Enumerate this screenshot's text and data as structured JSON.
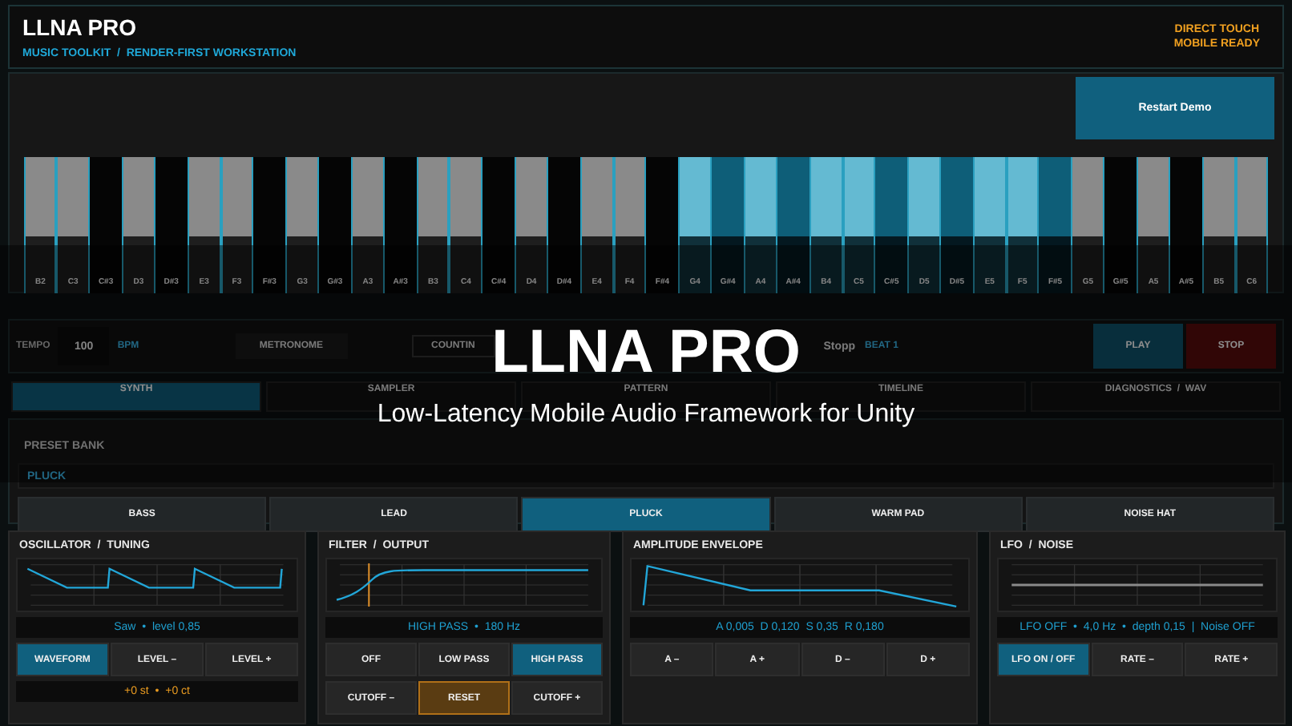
{
  "header": {
    "title": "LLNA PRO",
    "subtitle": "MUSIC TOOLKIT  /  RENDER-FIRST WORKSTATION",
    "badge_lines": [
      "DIRECT TOUCH",
      "MOBILE READY"
    ]
  },
  "restart_button": "Restart Demo",
  "keyboard": {
    "keys": [
      {
        "note": "B2",
        "kind": "white",
        "active": false
      },
      {
        "note": "C3",
        "kind": "white",
        "active": false
      },
      {
        "note": "C#3",
        "kind": "black",
        "active": false
      },
      {
        "note": "D3",
        "kind": "white",
        "active": false
      },
      {
        "note": "D#3",
        "kind": "black",
        "active": false
      },
      {
        "note": "E3",
        "kind": "white",
        "active": false
      },
      {
        "note": "F3",
        "kind": "white",
        "active": false
      },
      {
        "note": "F#3",
        "kind": "black",
        "active": false
      },
      {
        "note": "G3",
        "kind": "white",
        "active": false
      },
      {
        "note": "G#3",
        "kind": "black",
        "active": false
      },
      {
        "note": "A3",
        "kind": "white",
        "active": false
      },
      {
        "note": "A#3",
        "kind": "black",
        "active": false
      },
      {
        "note": "B3",
        "kind": "white",
        "active": false
      },
      {
        "note": "C4",
        "kind": "white",
        "active": false
      },
      {
        "note": "C#4",
        "kind": "black",
        "active": false
      },
      {
        "note": "D4",
        "kind": "white",
        "active": false
      },
      {
        "note": "D#4",
        "kind": "black",
        "active": false
      },
      {
        "note": "E4",
        "kind": "white",
        "active": false
      },
      {
        "note": "F4",
        "kind": "white",
        "active": false
      },
      {
        "note": "F#4",
        "kind": "black",
        "active": false
      },
      {
        "note": "G4",
        "kind": "white",
        "active": true
      },
      {
        "note": "G#4",
        "kind": "black",
        "active": true
      },
      {
        "note": "A4",
        "kind": "white",
        "active": true
      },
      {
        "note": "A#4",
        "kind": "black",
        "active": true
      },
      {
        "note": "B4",
        "kind": "white",
        "active": true
      },
      {
        "note": "C5",
        "kind": "white",
        "active": true
      },
      {
        "note": "C#5",
        "kind": "black",
        "active": true
      },
      {
        "note": "D5",
        "kind": "white",
        "active": true
      },
      {
        "note": "D#5",
        "kind": "black",
        "active": true
      },
      {
        "note": "E5",
        "kind": "white",
        "active": true
      },
      {
        "note": "F5",
        "kind": "white",
        "active": true
      },
      {
        "note": "F#5",
        "kind": "black",
        "active": true
      },
      {
        "note": "G5",
        "kind": "white",
        "active": false
      },
      {
        "note": "G#5",
        "kind": "black",
        "active": false
      },
      {
        "note": "A5",
        "kind": "white",
        "active": false
      },
      {
        "note": "A#5",
        "kind": "black",
        "active": false
      },
      {
        "note": "B5",
        "kind": "white",
        "active": false
      },
      {
        "note": "C6",
        "kind": "white",
        "active": false
      }
    ]
  },
  "transport": {
    "tempo_label": "TEMPO",
    "tempo_value": "100",
    "tempo_unit": "BPM",
    "metronome": {
      "label": "METRONOME",
      "on": false
    },
    "count_in": {
      "label": "COUNTIN",
      "on": false
    },
    "status": "Stopp",
    "beat": "BEAT 1",
    "play": "PLAY",
    "stop": "STOP"
  },
  "tabs": [
    {
      "label": "SYNTH",
      "selected": true
    },
    {
      "label": "SAMPLER",
      "selected": false
    },
    {
      "label": "PATTERN",
      "selected": false
    },
    {
      "label": "TIMELINE",
      "selected": false
    },
    {
      "label": "DIAGNOSTICS  /  WAV",
      "selected": false
    }
  ],
  "preset_bank": {
    "title": "PRESET BANK",
    "current": "PLUCK",
    "presets": [
      {
        "label": "BASS",
        "selected": false
      },
      {
        "label": "LEAD",
        "selected": false
      },
      {
        "label": "PLUCK",
        "selected": true
      },
      {
        "label": "WARM PAD",
        "selected": false
      },
      {
        "label": "NOISE HAT",
        "selected": false
      }
    ]
  },
  "panels": [
    {
      "kind": "oscillator",
      "title": "OSCILLATOR  /  TUNING",
      "rows": [
        {
          "kind": "readout",
          "color": "#1fa0d0",
          "text": "Saw  •  level 0,85"
        },
        {
          "kind": "buttons",
          "buttons": [
            {
              "label": "WAVEFORM",
              "selected": true
            },
            {
              "label": "LEVEL –",
              "selected": false
            },
            {
              "label": "LEVEL +",
              "selected": false
            }
          ]
        },
        {
          "kind": "readout",
          "color": "#e89a20",
          "text": "+0 st  •  +0 ct"
        }
      ]
    },
    {
      "kind": "filter",
      "title": "FILTER  /  OUTPUT",
      "rows": [
        {
          "kind": "readout",
          "color": "#1fa0d0",
          "text": "HIGH PASS  •  180 Hz"
        },
        {
          "kind": "buttons",
          "buttons": [
            {
              "label": "OFF",
              "selected": false
            },
            {
              "label": "LOW PASS",
              "selected": false
            },
            {
              "label": "HIGH PASS",
              "selected": true
            }
          ]
        },
        {
          "kind": "buttons",
          "buttons": [
            {
              "label": "CUTOFF –",
              "kind": "normal"
            },
            {
              "label": "RESET",
              "kind": "accent"
            },
            {
              "label": "CUTOFF +",
              "kind": "normal"
            }
          ]
        }
      ]
    },
    {
      "kind": "envelope",
      "title": "AMPLITUDE ENVELOPE",
      "rows": [
        {
          "kind": "readout",
          "color": "#1fa0d0",
          "text": "A 0,005  D 0,120  S 0,35  R 0,180"
        },
        {
          "kind": "buttons",
          "buttons": [
            {
              "label": "A –",
              "selected": false
            },
            {
              "label": "A +",
              "selected": false
            },
            {
              "label": "D –",
              "selected": false
            },
            {
              "label": "D +",
              "selected": false
            }
          ]
        }
      ]
    },
    {
      "kind": "lfo",
      "title": "LFO  /  NOISE",
      "rows": [
        {
          "kind": "readout",
          "color": "#1fa0d0",
          "text": "LFO OFF  •  4,0 Hz  •  depth 0,15  |  Noise OFF"
        },
        {
          "kind": "buttons",
          "buttons": [
            {
              "label": "LFO ON / OFF",
              "selected": true
            },
            {
              "label": "RATE –",
              "selected": false
            },
            {
              "label": "RATE +",
              "selected": false
            }
          ]
        }
      ]
    }
  ],
  "overlay": {
    "title": "LLNA PRO",
    "subtitle": "Low-Latency Mobile Audio Framework for Unity"
  }
}
